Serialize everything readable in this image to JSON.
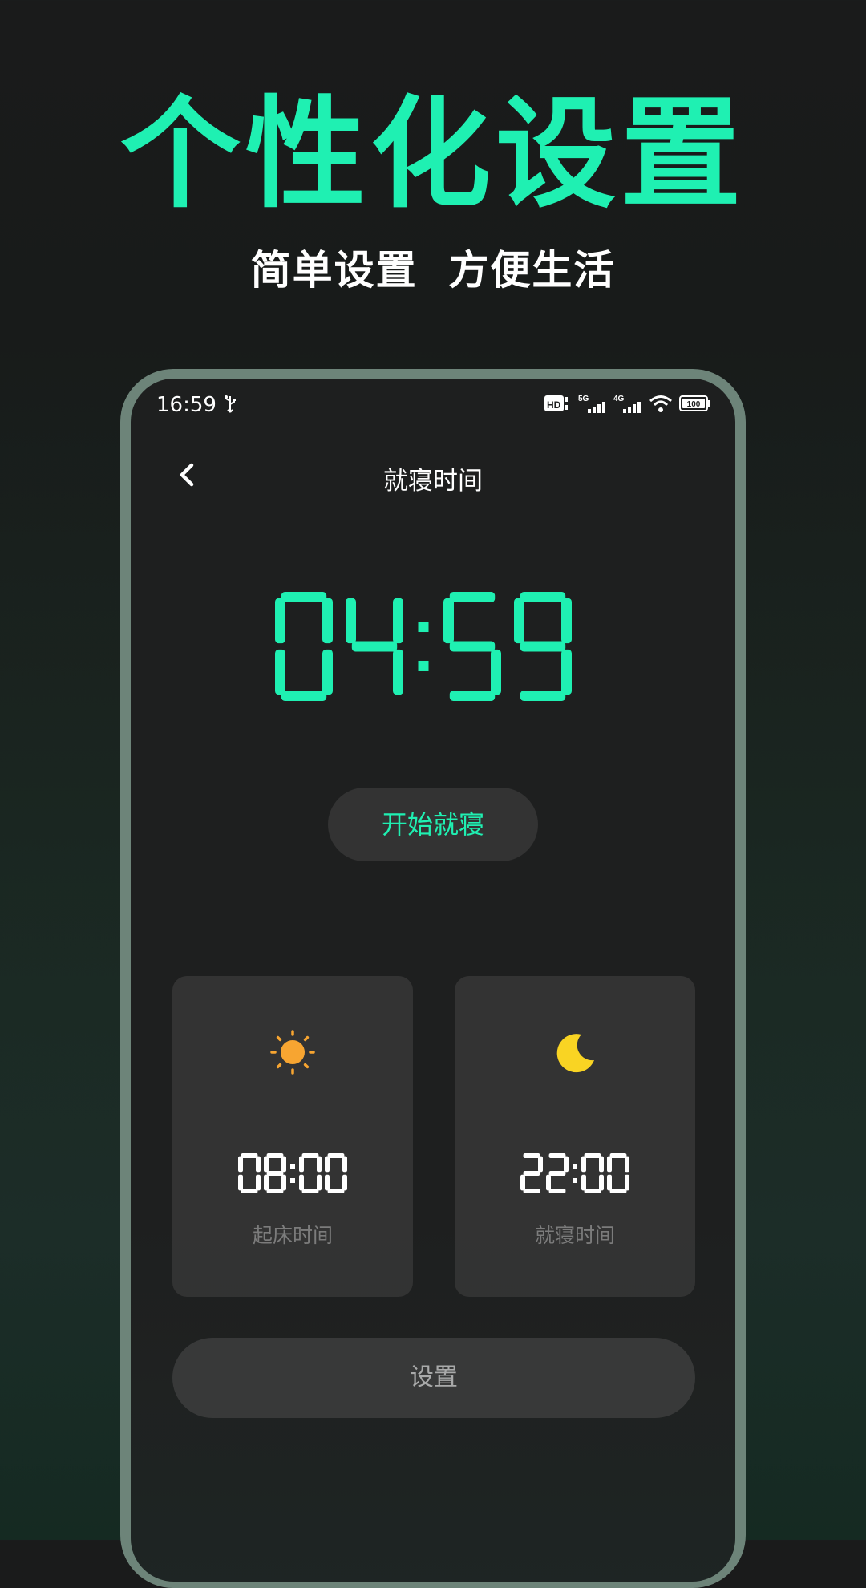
{
  "promo": {
    "title": "个性化设置",
    "subtitle": "简单设置  方便生活"
  },
  "status_bar": {
    "time": "16:59",
    "network_labels": [
      "HD",
      "5G",
      "4G"
    ],
    "battery": "100",
    "icons": [
      "usb-icon",
      "hd-icon",
      "signal-5g-icon",
      "signal-4g-icon",
      "wifi-icon",
      "battery-icon"
    ]
  },
  "header": {
    "title": "就寝时间",
    "back_icon": "chevron-left-icon"
  },
  "countdown": {
    "value": "04:59"
  },
  "start_button": {
    "label": "开始就寝"
  },
  "cards": [
    {
      "icon": "sun-icon",
      "time": "08:00",
      "label": "起床时间"
    },
    {
      "icon": "moon-icon",
      "time": "22:00",
      "label": "就寝时间"
    }
  ],
  "set_button": {
    "label": "设置"
  },
  "colors": {
    "accent": "#1ff0b2",
    "background": "#1e1f1f",
    "card": "#333333",
    "sun": "#f7a531",
    "moon": "#f9d423"
  }
}
